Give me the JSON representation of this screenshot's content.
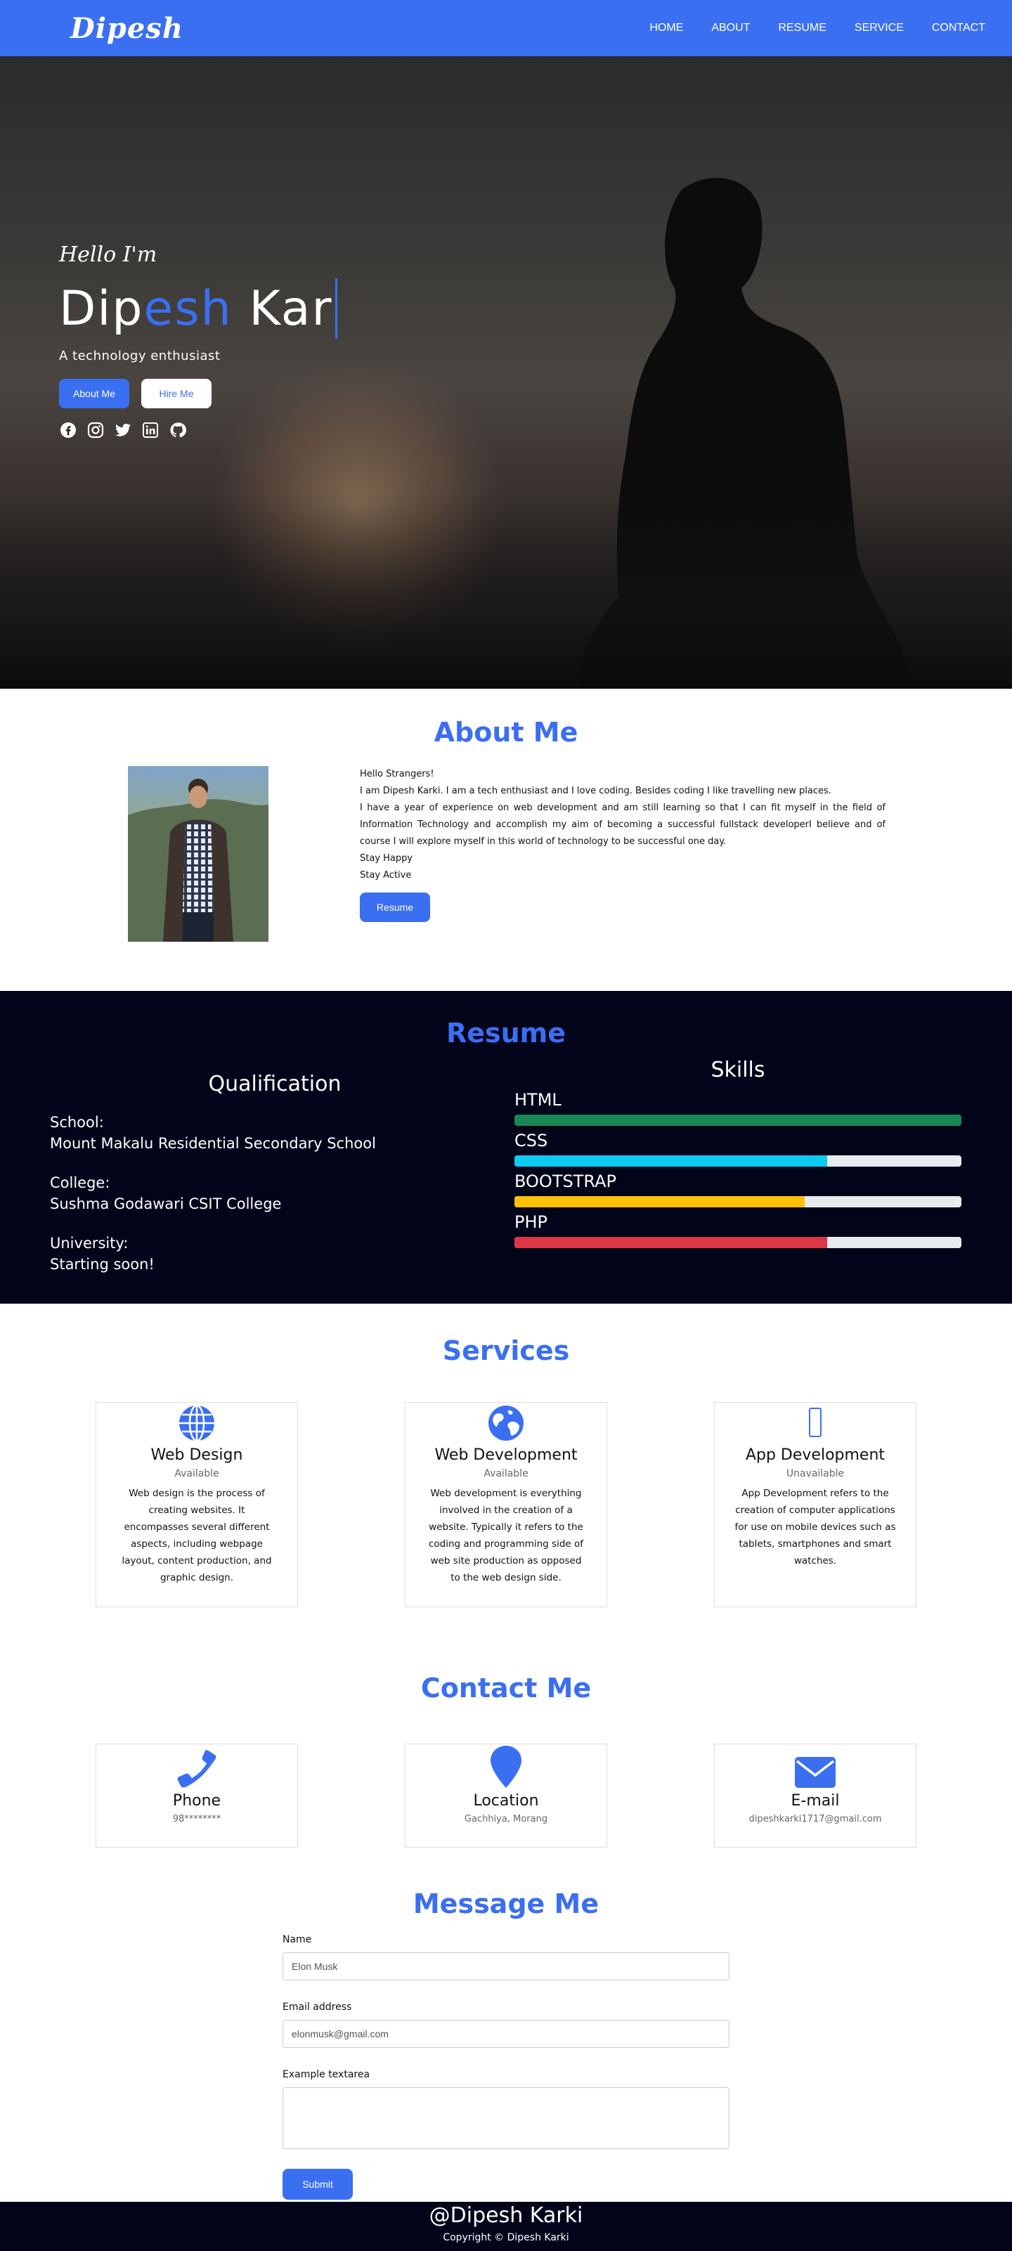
{
  "nav": {
    "brand": "Dipesh",
    "links": [
      "HOME",
      "ABOUT",
      "RESUME",
      "SERVICE",
      "CONTACT"
    ]
  },
  "hero": {
    "greeting": "Hello I'm",
    "name_part1": "Dip",
    "name_part2": "esh",
    "name_part3": " Kar",
    "tagline": "A technology enthusiast",
    "btn_about": "About Me",
    "btn_hire": "Hire Me",
    "socials": [
      "facebook-icon",
      "instagram-icon",
      "twitter-icon",
      "linkedin-icon",
      "github-icon"
    ]
  },
  "about": {
    "title": "About Me",
    "lines": [
      "Hello Strangers!",
      "I am Dipesh Karki. I am a tech enthusiast and I love coding. Besides coding I like travelling new places.",
      "I have a year of experience on web development and am still learning so that I can fit myself in the field of Information Technology and accomplish my aim of becoming a successful fullstack developerI believe and of course I will explore myself in this world of technology to be successful one day.",
      "Stay Happy",
      "Stay Active"
    ],
    "btn_resume": "Resume"
  },
  "resume": {
    "title": "Resume",
    "qualification_title": "Qualification",
    "qualifications": [
      {
        "label": "School:",
        "value": "Mount Makalu Residential Secondary School"
      },
      {
        "label": "College:",
        "value": "Sushma Godawari CSIT College"
      },
      {
        "label": "University:",
        "value": "Starting soon!"
      }
    ],
    "skills_title": "Skills",
    "skills": [
      {
        "name": "HTML",
        "level": 100,
        "color": "#198754"
      },
      {
        "name": "CSS",
        "level": 70,
        "color": "#0dcaf0"
      },
      {
        "name": "BOOTSTRAP",
        "level": 65,
        "color": "#ffc107"
      },
      {
        "name": "PHP",
        "level": 70,
        "color": "#dc3545"
      }
    ]
  },
  "services": {
    "title": "Services",
    "items": [
      {
        "icon": "globe-icon",
        "title": "Web Design",
        "status": "Available",
        "desc": "Web design is the process of creating websites. It encompasses several different aspects, including webpage layout, content production, and graphic design."
      },
      {
        "icon": "earth-icon",
        "title": "Web Development",
        "status": "Available",
        "desc": "Web development is everything involved in the creation of a website. Typically it refers to the coding and programming side of web site production as opposed to the web design side."
      },
      {
        "icon": "mobile-icon",
        "title": "App Development",
        "status": "Unavailable",
        "desc": "App Development refers to the creation of computer applications for use on mobile devices such as tablets, smartphones and smart watches."
      }
    ]
  },
  "contact": {
    "title": "Contact Me",
    "items": [
      {
        "icon": "phone-icon",
        "title": "Phone",
        "value": "98********"
      },
      {
        "icon": "location-icon",
        "title": "Location",
        "value": "Gachhiya, Morang"
      },
      {
        "icon": "email-icon",
        "title": "E-mail",
        "value": "dipeshkarki1717@gmail.com"
      }
    ]
  },
  "message": {
    "title": "Message Me",
    "name_label": "Name",
    "name_value": "Elon Musk",
    "email_label": "Email address",
    "email_value": "elonmusk@gmail.com",
    "textarea_label": "Example textarea",
    "submit": "Submit"
  },
  "footer": {
    "handle": "@Dipesh Karki",
    "copyright": "Copyright © Dipesh Karki"
  },
  "colors": {
    "accent": "#3b6ff2",
    "dark": "#02041a"
  }
}
